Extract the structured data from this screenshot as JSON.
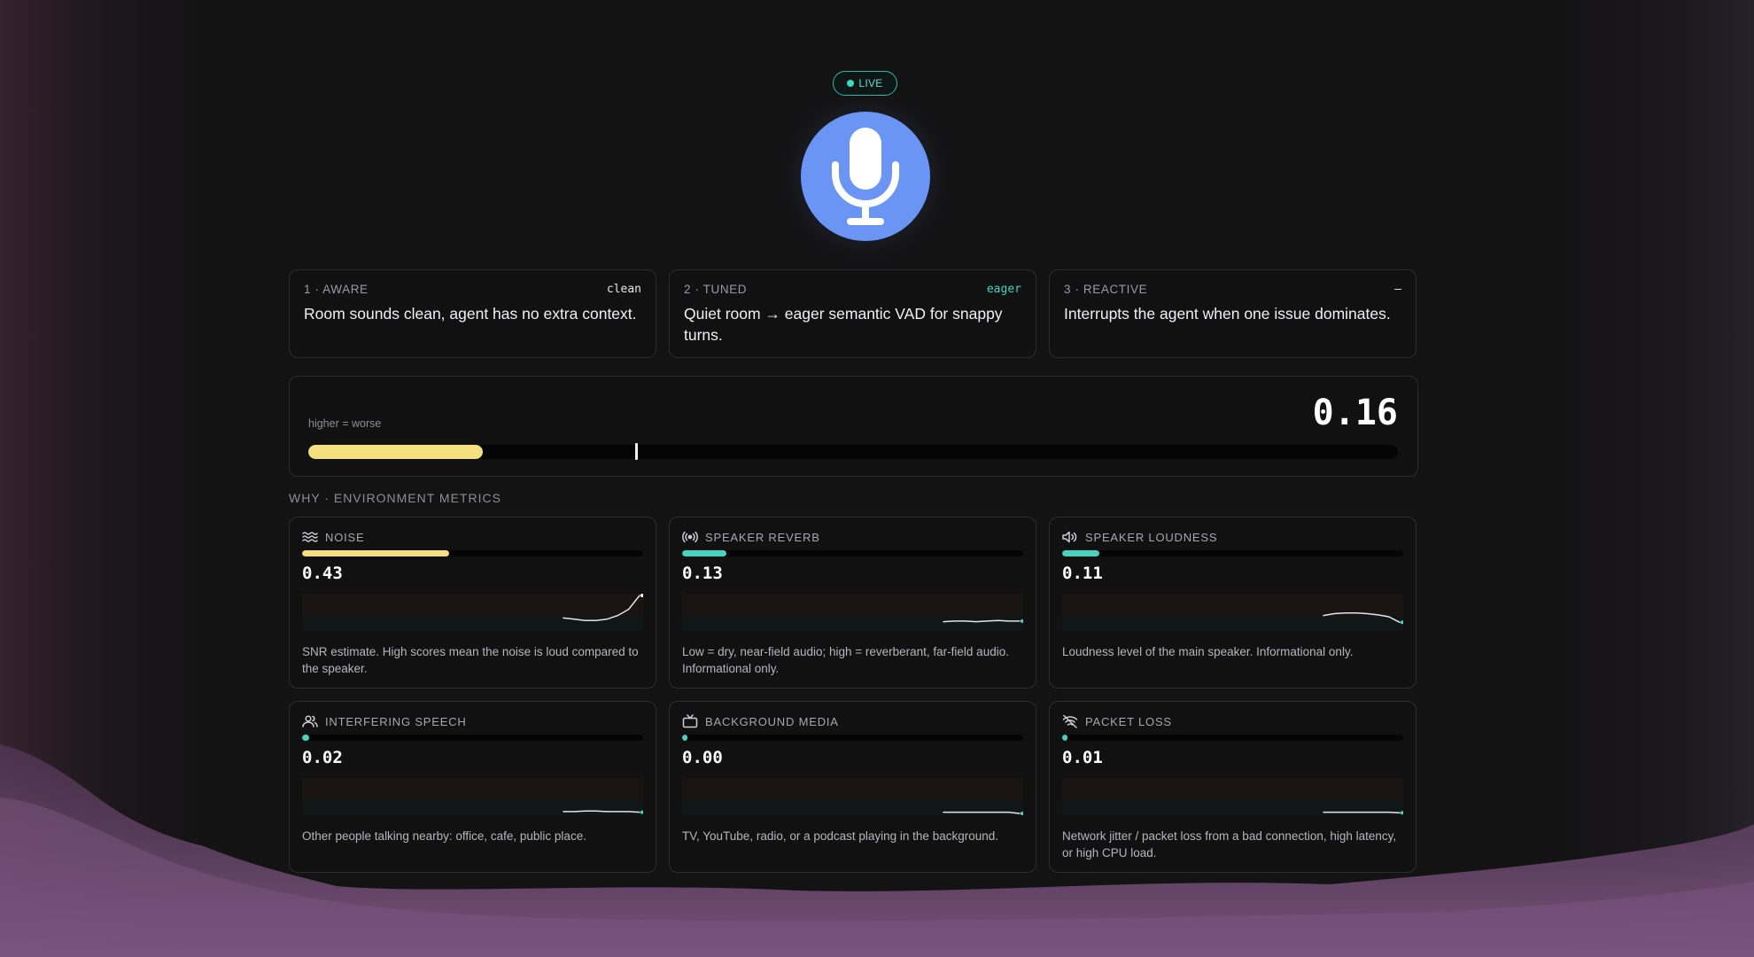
{
  "status": {
    "label": "LIVE"
  },
  "stages": [
    {
      "label": "1 · AWARE",
      "tag": "clean",
      "text": "Room sounds clean, agent has no extra context."
    },
    {
      "label": "2 · TUNED",
      "tag": "eager",
      "text": "Quiet room → eager semantic VAD for snappy turns."
    },
    {
      "label": "3 · REACTIVE",
      "tag": "–",
      "text": "Interrupts the agent when one issue dominates."
    }
  ],
  "overall": {
    "hint": "higher = worse",
    "value": "0.16",
    "fill_fraction": 0.16,
    "threshold_fraction": 0.3,
    "fill_color": "#f4e07e"
  },
  "section_title": "WHY · ENVIRONMENT METRICS",
  "metrics": [
    {
      "name": "NOISE",
      "icon": "waves-icon",
      "value": "0.43",
      "level": 0.43,
      "color": "#f4e07e",
      "desc": "SNR estimate. High scores mean the noise is loud compared to the speaker.",
      "spark": [
        0.18,
        0.16,
        0.14,
        0.14,
        0.16,
        0.22,
        0.32,
        0.55
      ]
    },
    {
      "name": "SPEAKER REVERB",
      "icon": "broadcast-icon",
      "value": "0.13",
      "level": 0.13,
      "color": "#48d3bf",
      "desc": "Low = dry, near-field audio; high = reverberant, far-field audio. Informational only.",
      "spark": [
        0.12,
        0.13,
        0.13,
        0.12,
        0.13,
        0.14,
        0.13,
        0.13
      ]
    },
    {
      "name": "SPEAKER LOUDNESS",
      "icon": "speaker-icon",
      "value": "0.11",
      "level": 0.11,
      "color": "#48d3bf",
      "desc": "Loudness level of the main speaker. Informational only.",
      "spark": [
        0.22,
        0.25,
        0.26,
        0.26,
        0.25,
        0.23,
        0.2,
        0.11
      ]
    },
    {
      "name": "INTERFERING SPEECH",
      "icon": "users-icon",
      "value": "0.02",
      "level": 0.02,
      "color": "#48d3bf",
      "desc": "Other people talking nearby: office, cafe, public place.",
      "spark": [
        0.03,
        0.03,
        0.04,
        0.04,
        0.03,
        0.03,
        0.03,
        0.02
      ]
    },
    {
      "name": "BACKGROUND MEDIA",
      "icon": "tv-icon",
      "value": "0.00",
      "level": 0.0,
      "color": "#48d3bf",
      "desc": "TV, YouTube, radio, or a podcast playing in the background.",
      "spark": [
        0.02,
        0.02,
        0.02,
        0.02,
        0.02,
        0.02,
        0.02,
        0.0
      ]
    },
    {
      "name": "PACKET LOSS",
      "icon": "wifi-off-icon",
      "value": "0.01",
      "level": 0.01,
      "color": "#48d3bf",
      "desc": "Network jitter / packet loss from a bad connection, high latency, or high CPU load.",
      "spark": [
        0.02,
        0.02,
        0.02,
        0.02,
        0.02,
        0.02,
        0.02,
        0.01
      ]
    }
  ]
}
